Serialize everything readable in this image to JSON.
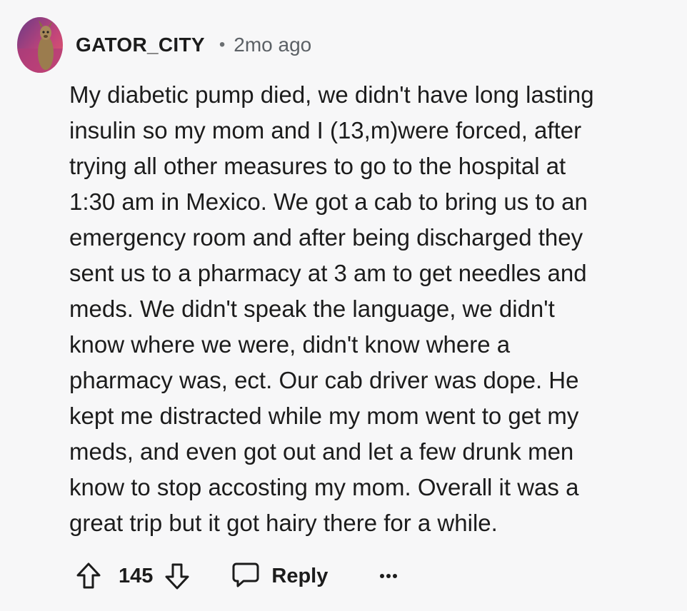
{
  "comment": {
    "author": "GATOR_CITY",
    "separator": "•",
    "timestamp": "2mo ago",
    "body": "My diabetic pump died, we didn't have long lasting\ninsulin so my mom and I (13,m)were forced, after\ntrying all other measures to go to the hospital at\n1:30 am in Mexico. We got a cab to bring us to an\nemergency room and after being discharged they\nsent us to a pharmacy at 3 am to get needles and\nmeds. We didn't speak the language, we didn't\nknow where we were, didn't know where a\npharmacy was, ect. Our cab driver was dope. He\nkept me distracted while my mom went to get my\nmeds, and even got out and let a few drunk men\nknow to stop accosting my mom. Overall it was a\ngreat trip but it got hairy there for a while.",
    "score": "145",
    "reply_label": "Reply"
  },
  "icons": {
    "avatar": "avatar-image",
    "upvote": "arrow-up-icon",
    "downvote": "arrow-down-icon",
    "reply": "speech-bubble-icon",
    "more": "more-dots-icon"
  },
  "colors": {
    "background": "#f7f7f8",
    "text": "#1c1c1c",
    "meta": "#5c6166"
  }
}
